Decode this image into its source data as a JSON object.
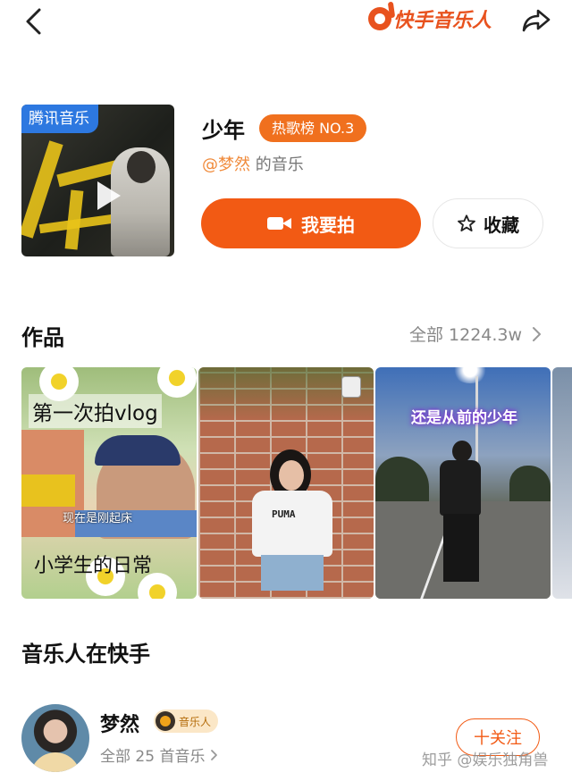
{
  "app": {
    "logo_text": "快手音乐人",
    "brand_color": "#f25a14"
  },
  "icons": {
    "back": "chevron-left-icon",
    "share": "share-arrow-icon",
    "camera": "video-camera-icon",
    "star": "star-outline-icon"
  },
  "song": {
    "album_badge": "腾讯音乐",
    "title": "少年",
    "rank_badge": "热歌榜 NO.3",
    "artist_at": "@梦然",
    "artist_suffix": " 的音乐",
    "shoot_label": "我要拍",
    "favorite_label": "收藏"
  },
  "works": {
    "title": "作品",
    "all_label": "全部 1224.3w",
    "videos": [
      {
        "top_text": "第一次拍vlog",
        "mid_text": "现在是刚起床",
        "bottom_text": "小学生的日常"
      },
      {
        "shirt_text": "PUMA"
      },
      {
        "overlay_text": "还是从前的少年"
      },
      {}
    ]
  },
  "musician": {
    "section_title": "音乐人在快手",
    "name": "梦然",
    "badge": "音乐人",
    "sub_label": "全部 25 首音乐",
    "follow_label": "十关注"
  },
  "watermark": "知乎 @娱乐独角兽"
}
